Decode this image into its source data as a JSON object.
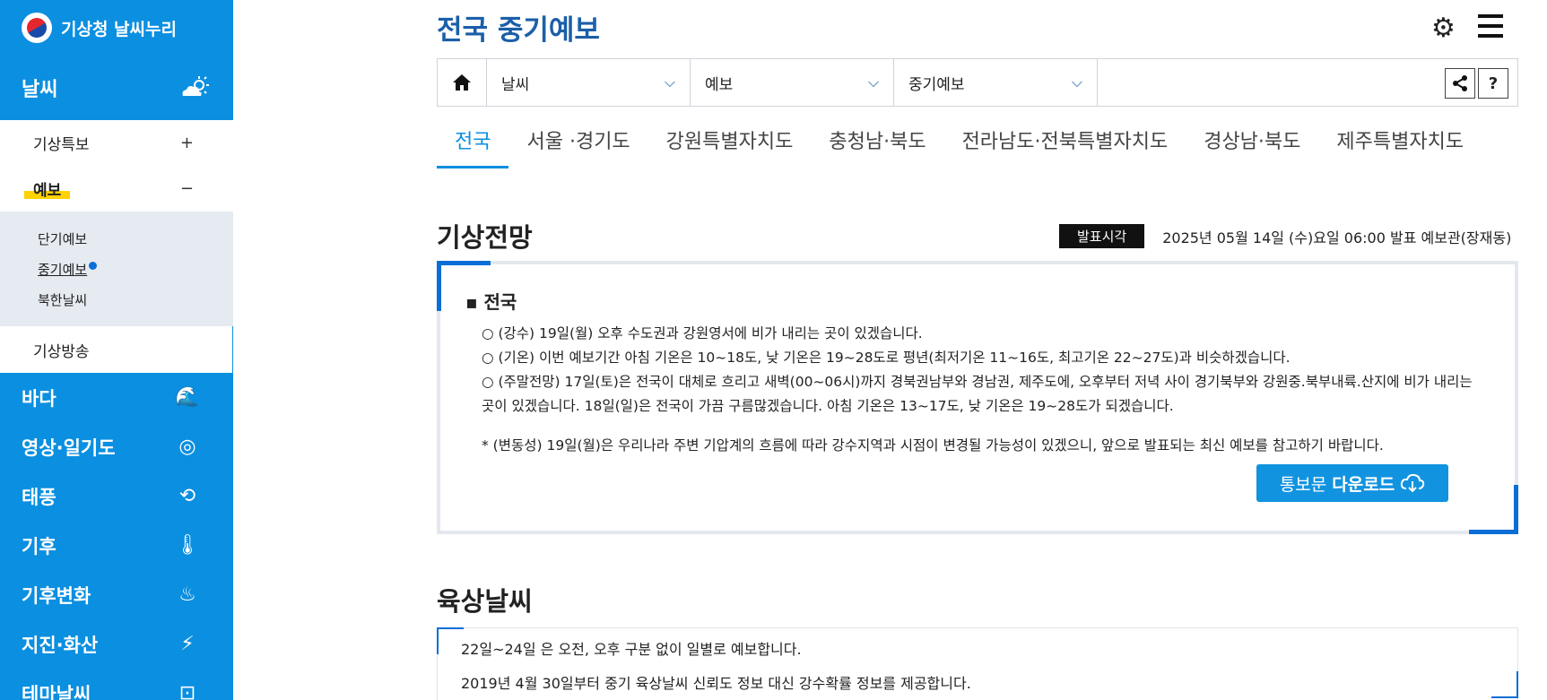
{
  "sidebar": {
    "brand": "기상청 날씨누리",
    "section_title": "날씨",
    "sub": [
      {
        "label": "기상특보",
        "sign": "+"
      },
      {
        "label": "예보",
        "sign": "−"
      }
    ],
    "third": [
      "단기예보",
      "중기예보",
      "북한날씨"
    ],
    "broadcast": "기상방송",
    "main": [
      {
        "label": "바다",
        "icon": "🌊"
      },
      {
        "label": "영상·일기도",
        "icon": "◎"
      },
      {
        "label": "태풍",
        "icon": "⟲"
      },
      {
        "label": "기후",
        "icon": "🌡"
      },
      {
        "label": "기후변화",
        "icon": "♨"
      },
      {
        "label": "지진·화산",
        "icon": "⚡"
      },
      {
        "label": "테마날씨",
        "icon": "⊡"
      }
    ]
  },
  "header": {
    "title": "전국 중기예보"
  },
  "breadcrumb": {
    "items": [
      "날씨",
      "예보",
      "중기예보"
    ],
    "help": "?"
  },
  "tabs": [
    "전국",
    "서울 ·경기도",
    "강원특별자치도",
    "충청남·북도",
    "전라남도·전북특별자치도",
    "경상남·북도",
    "제주특별자치도"
  ],
  "forecast": {
    "title": "기상전망",
    "announce_tag": "발표시각",
    "announce_time": "2025년 05월 14일 (수)요일 06:00 발표 예보관(장재동)",
    "region": "전국",
    "lines": [
      "○ (강수) 19일(월) 오후 수도권과 강원영서에 비가 내리는 곳이 있겠습니다.",
      "○ (기온) 이번 예보기간 아침 기온은 10~18도, 낮 기온은 19~28도로 평년(최저기온 11~16도, 최고기온 22~27도)과 비슷하겠습니다.",
      "○ (주말전망) 17일(토)은 전국이 대체로 흐리고 새벽(00~06시)까지 경북권남부와 경남권, 제주도에, 오후부터 저녁 사이 경기북부와 강원중.북부내륙.산지에 비가 내리는 곳이 있겠습니다. 18일(일)은 전국이 가끔 구름많겠습니다. 아침 기온은 13~17도, 낮 기온은 19~28도가 되겠습니다."
    ],
    "note": "* (변동성) 19일(월)은 우리나라 주변 기압계의 흐름에 따라 강수지역과 시점이 변경될 가능성이 있겠으니, 앞으로 발표되는 최신 예보를 참고하기 바랍니다.",
    "download_prefix": "통보문",
    "download_bold": "다운로드"
  },
  "land": {
    "title": "육상날씨",
    "line1": "22일~24일 은 오전, 오후 구분 없이 일별로 예보합니다.",
    "line2": "2019년 4월 30일부터 중기 육상날씨 신뢰도 정보 대신 강수확률 정보를 제공합니다."
  }
}
